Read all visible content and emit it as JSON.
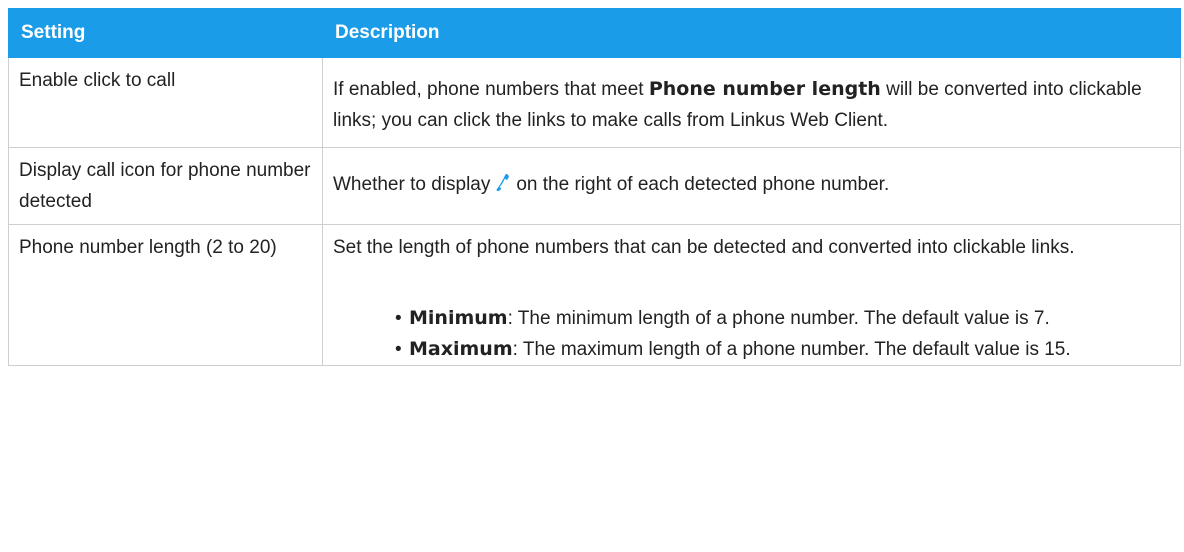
{
  "table": {
    "headers": {
      "setting": "Setting",
      "description": "Description"
    },
    "rows": [
      {
        "setting": "Enable click to call",
        "desc_prefix": "If enabled, phone numbers that meet ",
        "desc_bold": "Phone number length",
        "desc_suffix": " will be converted into clickable links; you can click the links to make calls from Linkus Web Client."
      },
      {
        "setting": "Display call icon for phone number detected",
        "desc_prefix": "Whether to display",
        "desc_icon": "phone-handset-icon",
        "desc_suffix": "on the right of each detected phone number."
      },
      {
        "setting": "Phone number length (2 to 20)",
        "desc_intro": "Set the length of phone numbers that can be detected and converted into clickable links.",
        "bullets": [
          {
            "term": "Minimum",
            "text": ": The minimum length of a phone number. The default value is 7."
          },
          {
            "term": "Maximum",
            "text": ": The maximum length of a phone number. The default value is 15."
          }
        ]
      }
    ]
  },
  "colors": {
    "header_bg": "#1b9ce9",
    "header_text": "#ffffff",
    "border": "#cfcfcf",
    "icon": "#1b9ce9"
  }
}
